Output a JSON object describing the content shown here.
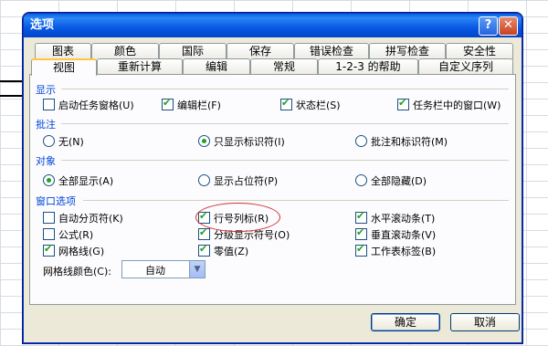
{
  "dialog": {
    "title": "选项",
    "help_symbol": "?",
    "close_symbol": "✕"
  },
  "tabs_row1": [
    "图表",
    "颜色",
    "国际",
    "保存",
    "错误检查",
    "拼写检查",
    "安全性"
  ],
  "tabs_row2": [
    "视图",
    "重新计算",
    "编辑",
    "常规",
    "1-2-3 的帮助",
    "自定义序列"
  ],
  "active_tab": "视图",
  "sections": {
    "display": {
      "title": "显示",
      "options": [
        {
          "label": "启动任务窗格(U)",
          "checked": false
        },
        {
          "label": "编辑栏(F)",
          "checked": true
        },
        {
          "label": "状态栏(S)",
          "checked": true
        },
        {
          "label": "任务栏中的窗口(W)",
          "checked": true
        }
      ]
    },
    "comments": {
      "title": "批注",
      "options": [
        {
          "label": "无(N)",
          "selected": false
        },
        {
          "label": "只显示标识符(I)",
          "selected": true
        },
        {
          "label": "批注和标识符(M)",
          "selected": false
        }
      ]
    },
    "objects": {
      "title": "对象",
      "options": [
        {
          "label": "全部显示(A)",
          "selected": true
        },
        {
          "label": "显示占位符(P)",
          "selected": false
        },
        {
          "label": "全部隐藏(D)",
          "selected": false
        }
      ]
    },
    "window": {
      "title": "窗口选项",
      "options": [
        {
          "label": "自动分页符(K)",
          "checked": false
        },
        {
          "label": "行号列标(R)",
          "checked": true
        },
        {
          "label": "水平滚动条(T)",
          "checked": true
        },
        {
          "label": "公式(R)",
          "checked": false
        },
        {
          "label": "分级显示符号(O)",
          "checked": true
        },
        {
          "label": "垂直滚动条(V)",
          "checked": true
        },
        {
          "label": "网格线(G)",
          "checked": true
        },
        {
          "label": "零值(Z)",
          "checked": true
        },
        {
          "label": "工作表标签(B)",
          "checked": true
        }
      ],
      "grid_color_label": "网格线颜色(C):",
      "grid_color_value": "自动"
    }
  },
  "buttons": {
    "ok": "确定",
    "cancel": "取消"
  },
  "colors": {
    "title_bar": "#0757e3",
    "section_title": "#0046d5",
    "annotation": "#d23232"
  }
}
